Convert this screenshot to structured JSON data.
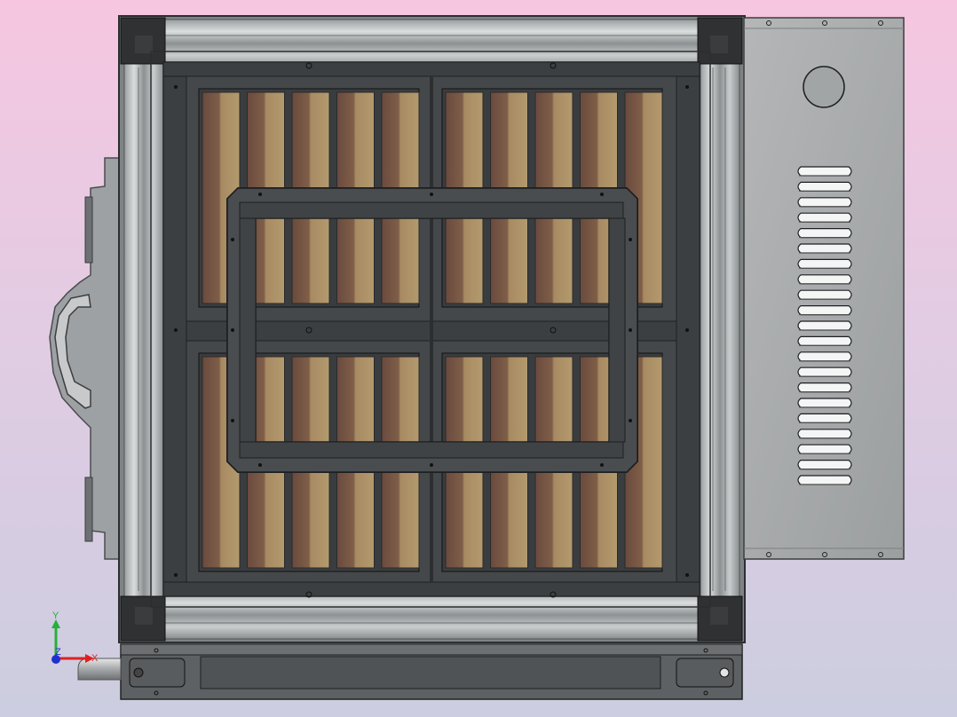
{
  "viewport": {
    "background_top": "#f6c6e0",
    "background_bottom": "#cccde0"
  },
  "model": {
    "frame_color": "#8e9294",
    "corner_color": "#2e3032",
    "inner_frame_color": "#3f4244",
    "filter_colors": [
      "#6e4c3e",
      "#a88a64",
      "#7a5a46"
    ],
    "panel_color": "#a7aaab",
    "filter_blocks": 4,
    "filter_strips_per_block": 5,
    "louver_slots": 21
  },
  "triad": {
    "y_label": "Y",
    "x_label": "X",
    "z_label": "Z",
    "y_color": "#27b03a",
    "x_color": "#e02020",
    "z_color": "#2030d0"
  }
}
